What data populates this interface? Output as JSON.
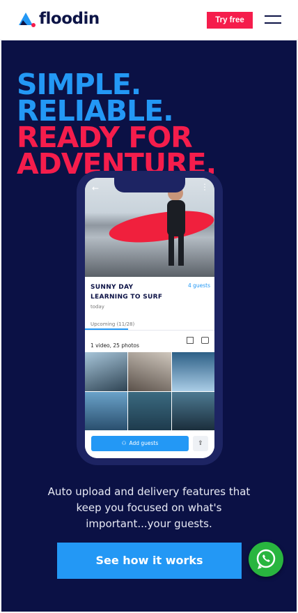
{
  "nav": {
    "brand": "floodin",
    "try_free_label": "Try free"
  },
  "hero": {
    "headline": [
      "SIMPLE.",
      "RELIABLE.",
      "READY FOR",
      "ADVENTURE."
    ],
    "tagline": "Auto upload and delivery features that keep you focused on what's important...your guests.",
    "cta_label": "See how it works"
  },
  "phone": {
    "event_title": "SUNNY DAY LEARNING TO SURF",
    "guests": "4 guests",
    "date": "today",
    "tab_label": "Upcoming (11/28)",
    "media_count": "1 video, 25 photos",
    "add_guests_label": "Add guests"
  },
  "colors": {
    "brand_navy": "#0b1145",
    "accent_blue": "#2398f5",
    "accent_red": "#f51d4c",
    "whatsapp_green": "#29b53f"
  },
  "icons": [
    "floodin-logo-icon",
    "menu-icon",
    "back-arrow-icon",
    "more-icon",
    "select-icon",
    "camera-icon",
    "add-user-icon",
    "share-icon",
    "whatsapp-icon"
  ]
}
